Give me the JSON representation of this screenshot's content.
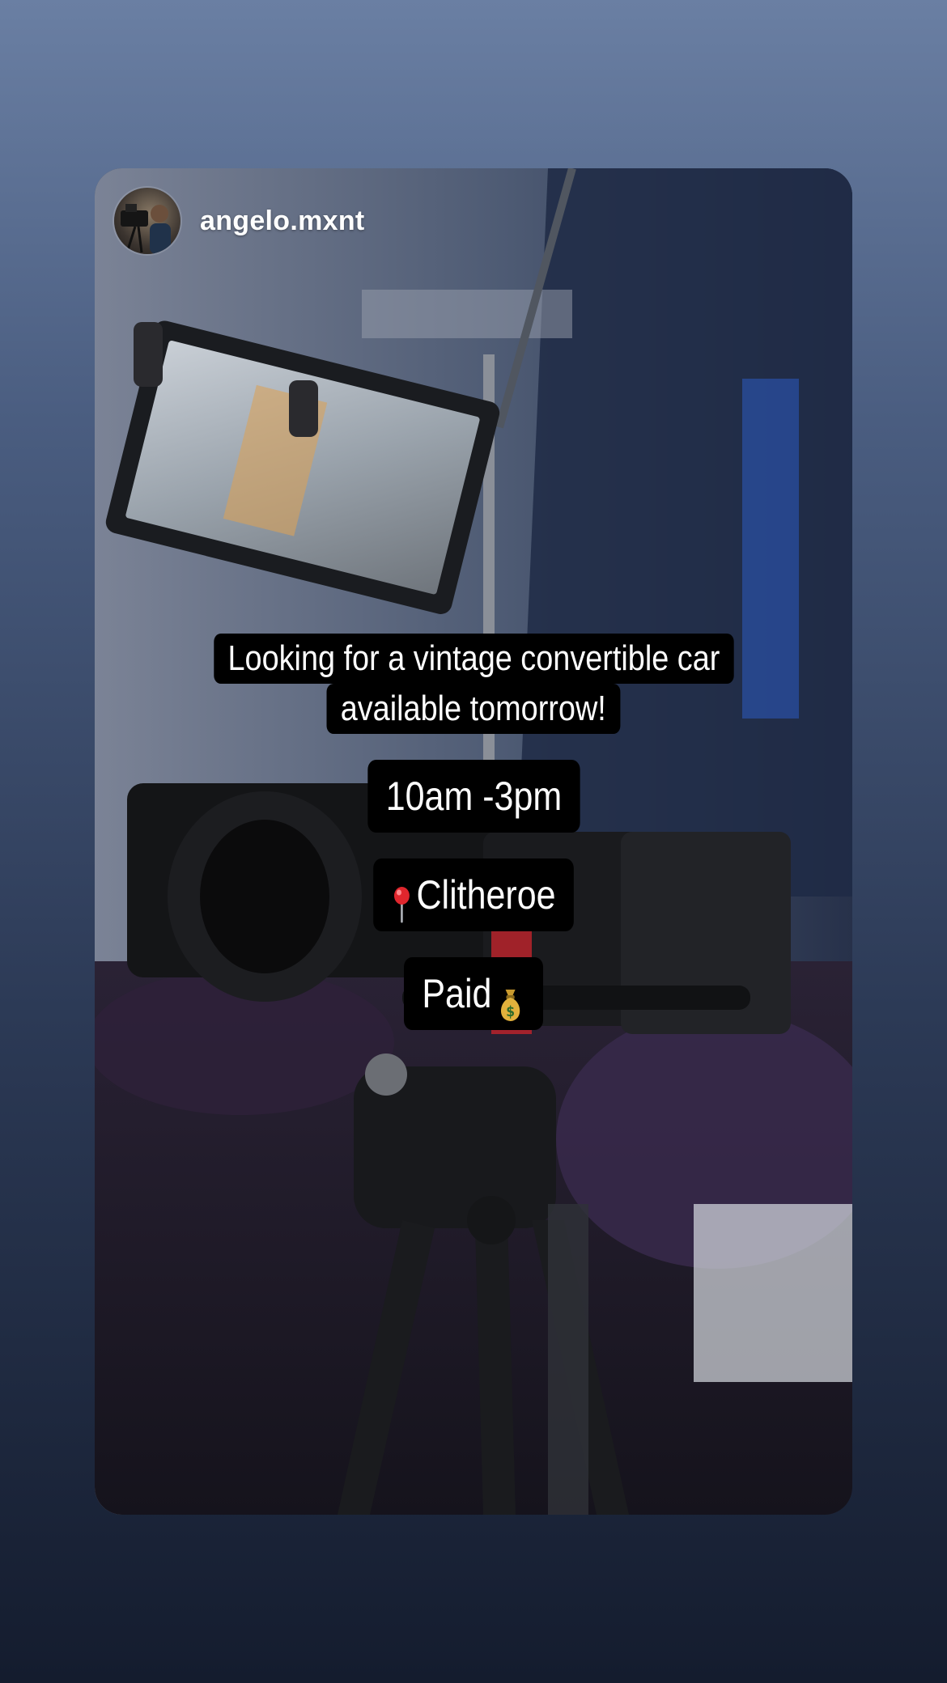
{
  "story": {
    "username": "angelo.mxnt",
    "caption_lines": [
      "Looking for a vintage convertible car",
      "available tomorrow!"
    ],
    "time": "10am -3pm",
    "location": "Clitheroe",
    "location_icon": "map-pin-icon",
    "payment": "Paid",
    "payment_icon": "money-bag-icon"
  }
}
